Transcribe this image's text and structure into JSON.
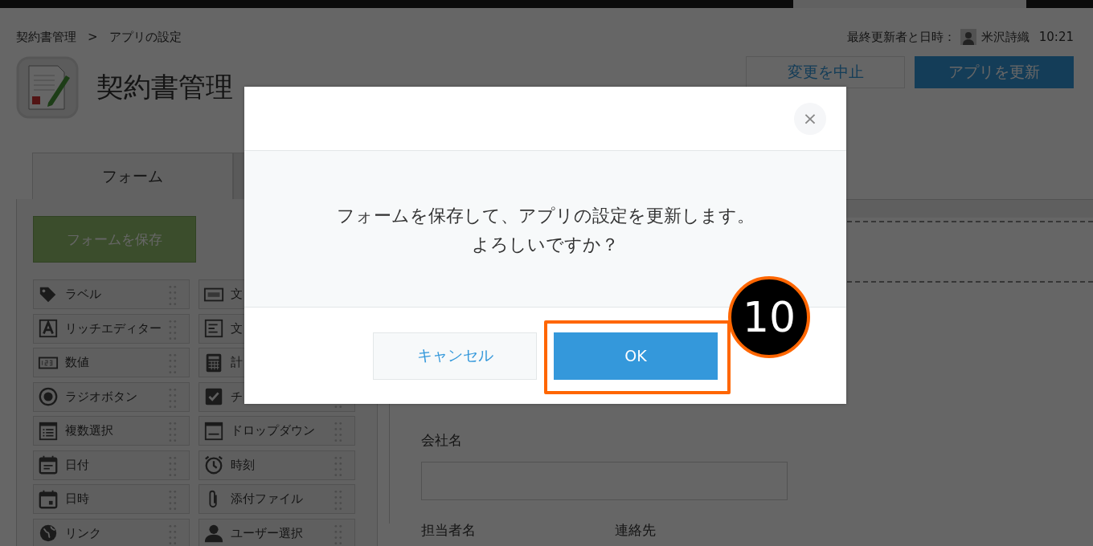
{
  "breadcrumb": {
    "items": [
      "契約書管理",
      "アプリの設定"
    ],
    "separator": ">"
  },
  "last_updated": {
    "label": "最終更新者と日時：",
    "user": "米沢詩織",
    "time": "10:21"
  },
  "app": {
    "title": "契約書管理"
  },
  "header_buttons": [
    {
      "label": "変更を中止",
      "kind": "secondary"
    },
    {
      "label": "アプリを更新",
      "kind": "primary"
    }
  ],
  "tabs": [
    {
      "label": "フォーム",
      "selected": true
    }
  ],
  "save_button": {
    "label": "フォームを保存"
  },
  "palette": [
    {
      "label": "ラベル",
      "kind": "tag",
      "handle": true
    },
    {
      "label": "文",
      "kind": "abc",
      "handle": false
    },
    {
      "label": "リッチエディター",
      "kind": "rich",
      "handle": true
    },
    {
      "label": "文",
      "kind": "lines",
      "handle": false
    },
    {
      "label": "数値",
      "kind": "number",
      "handle": true
    },
    {
      "label": "計",
      "kind": "calc",
      "handle": false
    },
    {
      "label": "ラジオボタン",
      "kind": "radio",
      "handle": true
    },
    {
      "label": "チ",
      "kind": "check",
      "handle": true
    },
    {
      "label": "複数選択",
      "kind": "multi",
      "handle": true
    },
    {
      "label": "ドロップダウン",
      "kind": "dropdown",
      "handle": true
    },
    {
      "label": "日付",
      "kind": "date",
      "handle": true
    },
    {
      "label": "時刻",
      "kind": "clock",
      "handle": true
    },
    {
      "label": "日時",
      "kind": "datetime",
      "handle": true
    },
    {
      "label": "添付ファイル",
      "kind": "clip",
      "handle": true
    },
    {
      "label": "リンク",
      "kind": "globe",
      "handle": true
    },
    {
      "label": "ユーザー選択",
      "kind": "user",
      "handle": true
    }
  ],
  "form": {
    "fields": [
      {
        "label": "会社名",
        "kind": "input"
      }
    ],
    "labels": [
      "担当者名",
      "連絡先"
    ]
  },
  "dialog": {
    "close": "×",
    "message_lines": [
      "フォームを保存して、アプリの設定を更新します。",
      "よろしいですか？"
    ],
    "buttons": [
      {
        "label": "キャンセル",
        "kind": "cancel",
        "highlighted": false
      },
      {
        "label": "OK",
        "kind": "ok",
        "highlighted": true
      }
    ]
  },
  "callout": {
    "number": "10"
  }
}
